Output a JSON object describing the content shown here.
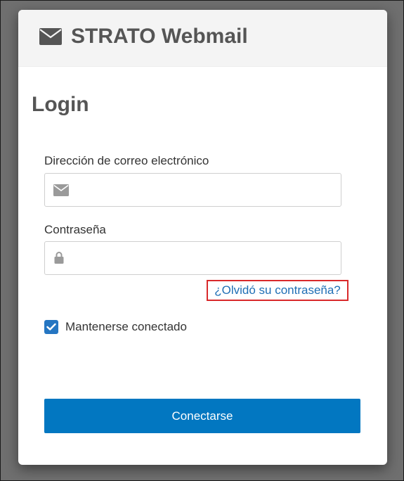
{
  "app": {
    "title": "STRATO Webmail",
    "icon": "envelope-icon"
  },
  "login": {
    "heading": "Login",
    "email": {
      "label": "Dirección de correo electrónico",
      "value": "",
      "placeholder": "",
      "icon": "envelope-icon"
    },
    "password": {
      "label": "Contraseña",
      "value": "",
      "placeholder": "",
      "icon": "lock-icon"
    },
    "forgot_password": "¿Olvidó su contraseña?",
    "remember": {
      "label": "Mantenerse conectado",
      "checked": true
    },
    "submit_label": "Conectarse"
  },
  "colors": {
    "accent": "#0277c1",
    "link": "#1f6fb5",
    "highlight_border": "#d9292b",
    "checkbox": "#2576c2",
    "text_heading": "#555555"
  }
}
